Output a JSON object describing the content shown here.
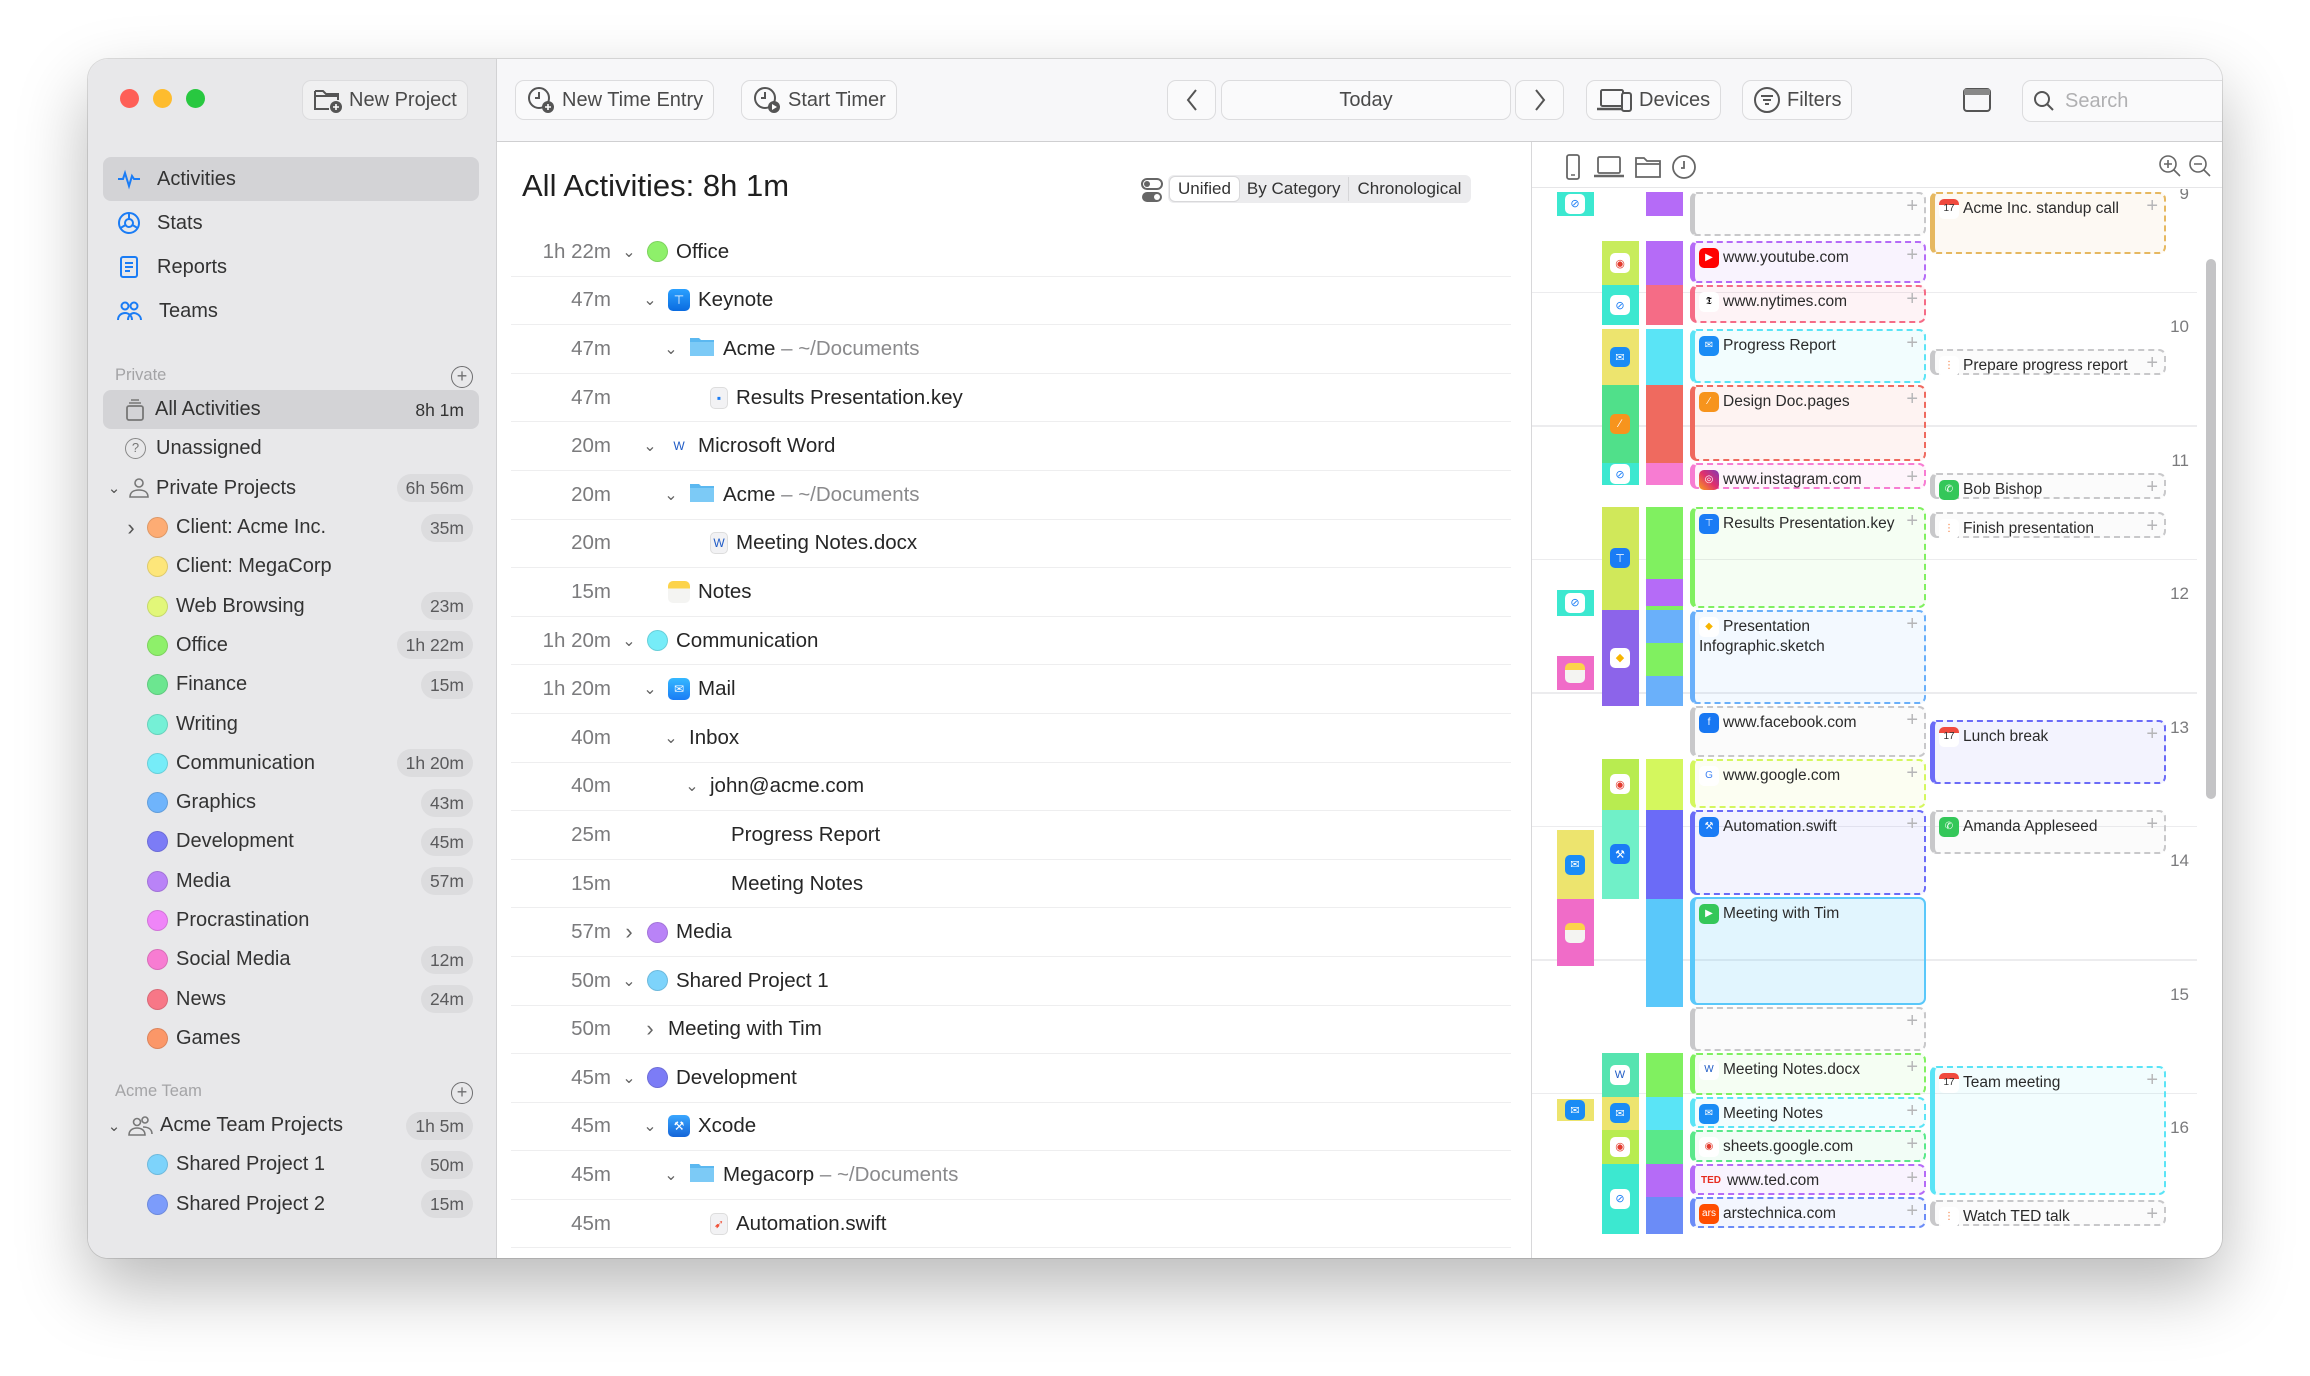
{
  "window": {
    "traffic_lights": [
      "#fe5f57",
      "#febc2e",
      "#28c840"
    ]
  },
  "sidebar": {
    "new_project_label": "New Project",
    "nav": [
      {
        "label": "Activities",
        "icon": "activity-icon",
        "active": true
      },
      {
        "label": "Stats",
        "icon": "stats-icon",
        "active": false
      },
      {
        "label": "Reports",
        "icon": "reports-icon",
        "active": false
      },
      {
        "label": "Teams",
        "icon": "teams-icon",
        "active": false
      }
    ],
    "private_section": {
      "title": "Private",
      "all_activities": {
        "label": "All Activities",
        "time": "8h 1m"
      },
      "unassigned": {
        "label": "Unassigned"
      },
      "group": {
        "label": "Private Projects",
        "time": "6h 56m"
      },
      "projects": [
        {
          "label": "Client: Acme Inc.",
          "time": "35m",
          "color": "#fdac74",
          "expandable": true
        },
        {
          "label": "Client: MegaCorp",
          "time": "",
          "color": "#fde67a"
        },
        {
          "label": "Web Browsing",
          "time": "23m",
          "color": "#e2f779"
        },
        {
          "label": "Office",
          "time": "1h 22m",
          "color": "#8ef06a"
        },
        {
          "label": "Finance",
          "time": "15m",
          "color": "#6ce690"
        },
        {
          "label": "Writing",
          "time": "",
          "color": "#75f0d6"
        },
        {
          "label": "Communication",
          "time": "1h 20m",
          "color": "#76ecf8"
        },
        {
          "label": "Graphics",
          "time": "43m",
          "color": "#6fb4fb"
        },
        {
          "label": "Development",
          "time": "45m",
          "color": "#7c7cf6"
        },
        {
          "label": "Media",
          "time": "57m",
          "color": "#b983f7"
        },
        {
          "label": "Procrastination",
          "time": "",
          "color": "#ef85f8"
        },
        {
          "label": "Social Media",
          "time": "12m",
          "color": "#f77cd2"
        },
        {
          "label": "News",
          "time": "24m",
          "color": "#f77787"
        },
        {
          "label": "Games",
          "time": "",
          "color": "#fb9768"
        }
      ]
    },
    "team_section": {
      "title": "Acme Team",
      "group": {
        "label": "Acme Team Projects",
        "time": "1h 5m"
      },
      "projects": [
        {
          "label": "Shared Project 1",
          "time": "50m",
          "color": "#7dd3fb"
        },
        {
          "label": "Shared Project 2",
          "time": "15m",
          "color": "#7c9cfb"
        }
      ]
    }
  },
  "toolbar": {
    "new_time_entry": "New Time Entry",
    "start_timer": "Start Timer",
    "date_label": "Today",
    "devices": "Devices",
    "filters": "Filters",
    "search_placeholder": "Search"
  },
  "main": {
    "title": "All Activities: 8h 1m",
    "view_modes": [
      "Unified",
      "By Category",
      "Chronological"
    ],
    "selected_view": "Unified",
    "rows": [
      {
        "time": "1h 22m",
        "level": 0,
        "chev": "down",
        "kind": "dot",
        "color": "#8ef06a",
        "label": "Office"
      },
      {
        "time": "47m",
        "level": 1,
        "chev": "down",
        "kind": "app",
        "icon": "keynote-icon",
        "label": "Keynote"
      },
      {
        "time": "47m",
        "level": 2,
        "chev": "down",
        "kind": "folder",
        "label": "Acme",
        "sub": " – ~/Documents"
      },
      {
        "time": "47m",
        "level": 3,
        "chev": "",
        "kind": "file",
        "icon": "keynote-file-icon",
        "label": "Results Presentation.key"
      },
      {
        "time": "20m",
        "level": 1,
        "chev": "down",
        "kind": "app",
        "icon": "word-icon",
        "label": "Microsoft Word"
      },
      {
        "time": "20m",
        "level": 2,
        "chev": "down",
        "kind": "folder",
        "label": "Acme",
        "sub": " – ~/Documents"
      },
      {
        "time": "20m",
        "level": 3,
        "chev": "",
        "kind": "file",
        "icon": "word-file-icon",
        "label": "Meeting Notes.docx"
      },
      {
        "time": "15m",
        "level": 1,
        "chev": "",
        "kind": "app",
        "icon": "notes-icon",
        "label": "Notes"
      },
      {
        "time": "1h 20m",
        "level": 0,
        "chev": "down",
        "kind": "dot",
        "color": "#76ecf8",
        "label": "Communication"
      },
      {
        "time": "1h 20m",
        "level": 1,
        "chev": "down",
        "kind": "app",
        "icon": "mail-icon",
        "label": "Mail"
      },
      {
        "time": "40m",
        "level": 2,
        "chev": "down",
        "kind": "none",
        "label": "Inbox"
      },
      {
        "time": "40m",
        "level": 3,
        "chev": "down",
        "kind": "none",
        "label": "john@acme.com"
      },
      {
        "time": "25m",
        "level": 4,
        "chev": "",
        "kind": "none",
        "label": "Progress Report"
      },
      {
        "time": "15m",
        "level": 4,
        "chev": "",
        "kind": "none",
        "label": "Meeting Notes"
      },
      {
        "time": "57m",
        "level": 0,
        "chev": "right",
        "kind": "dot",
        "color": "#b983f7",
        "label": "Media"
      },
      {
        "time": "50m",
        "level": 0,
        "chev": "down",
        "kind": "dot",
        "color": "#7dd3fb",
        "label": "Shared Project 1"
      },
      {
        "time": "50m",
        "level": 1,
        "chev": "right",
        "kind": "none",
        "label": "Meeting with Tim"
      },
      {
        "time": "45m",
        "level": 0,
        "chev": "down",
        "kind": "dot",
        "color": "#7c7cf6",
        "label": "Development"
      },
      {
        "time": "45m",
        "level": 1,
        "chev": "down",
        "kind": "app",
        "icon": "xcode-icon",
        "label": "Xcode"
      },
      {
        "time": "45m",
        "level": 2,
        "chev": "down",
        "kind": "folder",
        "label": "Megacorp",
        "sub": " – ~/Documents"
      },
      {
        "time": "45m",
        "level": 3,
        "chev": "",
        "kind": "file",
        "icon": "swift-file-icon",
        "label": "Automation.swift"
      }
    ]
  },
  "timeline": {
    "hours": [
      "9",
      "10",
      "11",
      "12",
      "13",
      "14",
      "15",
      "16"
    ],
    "activity_entries": [
      {
        "label": "",
        "color": "#c8c8ca",
        "start": 8.97,
        "end": 9.32,
        "icon": ""
      },
      {
        "label": "www.youtube.com",
        "color": "#b56bf7",
        "start": 9.34,
        "end": 9.67,
        "icon": "youtube-icon"
      },
      {
        "label": "www.nytimes.com",
        "color": "#f56c86",
        "start": 9.67,
        "end": 9.97,
        "icon": "nytimes-icon"
      },
      {
        "label": "Progress Report",
        "color": "#5ae4f6",
        "start": 10.0,
        "end": 10.42,
        "icon": "mail-icon"
      },
      {
        "label": "Design Doc.pages",
        "color": "#ef6a5f",
        "start": 10.42,
        "end": 11.0,
        "icon": "pages-icon"
      },
      {
        "label": "www.instagram.com",
        "color": "#f77cd2",
        "start": 11.0,
        "end": 11.17,
        "icon": "instagram-icon"
      },
      {
        "label": "Results Presentation.key",
        "color": "#80f060",
        "start": 11.33,
        "end": 12.1,
        "icon": "keynote-icon"
      },
      {
        "label": "Presentation Infographic.sketch",
        "color": "#6ab0fa",
        "start": 12.1,
        "end": 12.82,
        "icon": "sketch-icon"
      },
      {
        "label": "www.facebook.com",
        "color": "#c8c8ca",
        "start": 12.82,
        "end": 13.22,
        "icon": "facebook-icon"
      },
      {
        "label": "www.google.com",
        "color": "#d4f75e",
        "start": 13.22,
        "end": 13.6,
        "icon": "google-icon"
      },
      {
        "label": "Automation.swift",
        "color": "#6b6bf7",
        "start": 13.6,
        "end": 14.25,
        "icon": "xcode-icon"
      },
      {
        "label": "Meeting with Tim",
        "color": "#5ac8fa",
        "start": 14.25,
        "end": 15.08,
        "icon": "facetime-icon"
      },
      {
        "label": "",
        "color": "#c8c8ca",
        "start": 15.08,
        "end": 15.42,
        "icon": ""
      },
      {
        "label": "Meeting Notes.docx",
        "color": "#80f060",
        "start": 15.42,
        "end": 15.75,
        "icon": "word-icon"
      },
      {
        "label": "Meeting Notes",
        "color": "#5ae4f6",
        "start": 15.75,
        "end": 16.0,
        "icon": "mail-icon"
      },
      {
        "label": "sheets.google.com",
        "color": "#5ae88a",
        "start": 16.0,
        "end": 16.25,
        "icon": "chrome-icon"
      },
      {
        "label": "www.ted.com",
        "color": "#b56bf7",
        "start": 16.25,
        "end": 16.5,
        "icon": "ted-icon"
      },
      {
        "label": "arstechnica.com",
        "color": "#6b8cf7",
        "start": 16.5,
        "end": 16.75,
        "icon": "arstechnica-icon"
      }
    ],
    "calendar_entries": [
      {
        "label": "Acme Inc. standup call",
        "color": "#e6b860",
        "start": 8.97,
        "end": 9.45,
        "icon": "calendar-icon"
      },
      {
        "label": "Prepare progress report",
        "color": "#c8c8ca",
        "start": 10.15,
        "end": 10.32,
        "icon": "reminders-icon"
      },
      {
        "label": "Bob Bishop",
        "color": "#c8c8ca",
        "start": 11.08,
        "end": 11.25,
        "icon": "phone-icon"
      },
      {
        "label": "Finish presentation",
        "color": "#c8c8ca",
        "start": 11.37,
        "end": 11.55,
        "icon": "reminders-icon"
      },
      {
        "label": "Lunch break",
        "color": "#6b6bf7",
        "start": 12.93,
        "end": 13.42,
        "icon": "calendar-icon"
      },
      {
        "label": "Amanda Appleseed",
        "color": "#c8c8ca",
        "start": 13.6,
        "end": 13.95,
        "icon": "phone-icon"
      },
      {
        "label": "Team meeting",
        "color": "#5ae4f6",
        "start": 15.52,
        "end": 16.5,
        "icon": "calendar-icon"
      },
      {
        "label": "Watch TED talk",
        "color": "#c8c8ca",
        "start": 16.52,
        "end": 16.7,
        "icon": "reminders-icon"
      }
    ],
    "device_column": [
      {
        "icon": "safari-icon",
        "color": "#3ce8d0",
        "start": 8.97,
        "end": 9.15
      },
      {
        "icon": "safari-icon",
        "color": "#3ce8d0",
        "start": 11.95,
        "end": 12.15
      },
      {
        "icon": "notes-icon",
        "color": "#f06cc8",
        "start": 12.45,
        "end": 12.7
      },
      {
        "icon": "mail-icon",
        "color": "#ede46e",
        "start": 13.75,
        "end": 14.27
      },
      {
        "icon": "notes-icon",
        "color": "#f06cc8",
        "start": 14.27,
        "end": 14.77
      },
      {
        "icon": "mail-icon",
        "color": "#ede46e",
        "start": 15.77,
        "end": 15.93
      }
    ],
    "app_column": [
      {
        "icon": "chrome-icon",
        "color": "#c8ec5c",
        "start": 9.34,
        "end": 9.67
      },
      {
        "icon": "safari-icon",
        "color": "#3ce8d0",
        "start": 9.67,
        "end": 9.97
      },
      {
        "icon": "mail-icon",
        "color": "#ede46e",
        "start": 10.0,
        "end": 10.42
      },
      {
        "icon": "pages-icon",
        "color": "#50e08a",
        "start": 10.42,
        "end": 11.0
      },
      {
        "icon": "safari-icon",
        "color": "#3ce8d0",
        "start": 11.0,
        "end": 11.17
      },
      {
        "icon": "keynote-icon",
        "color": "#d0e85a",
        "start": 11.33,
        "end": 12.1
      },
      {
        "icon": "sketch-icon",
        "color": "#8c64ea",
        "start": 12.1,
        "end": 12.82
      },
      {
        "icon": "chrome-icon",
        "color": "#b8ec50",
        "start": 13.22,
        "end": 13.6
      },
      {
        "icon": "xcode-icon",
        "color": "#70f0c8",
        "start": 13.6,
        "end": 14.27
      },
      {
        "icon": "word-icon",
        "color": "#56e4b0",
        "start": 15.42,
        "end": 15.75
      },
      {
        "icon": "mail-icon",
        "color": "#ede46e",
        "start": 15.75,
        "end": 16.0
      },
      {
        "icon": "chrome-icon",
        "color": "#b8ec50",
        "start": 16.0,
        "end": 16.25
      },
      {
        "icon": "safari-icon",
        "color": "#3ce8d0",
        "start": 16.25,
        "end": 16.78
      }
    ],
    "category_column": [
      {
        "color": "#b56bf7",
        "start": 8.97,
        "end": 9.15
      },
      {
        "color": "#b56bf7",
        "start": 9.34,
        "end": 9.67
      },
      {
        "color": "#f56c86",
        "start": 9.67,
        "end": 9.97
      },
      {
        "color": "#5ae4f6",
        "start": 10.0,
        "end": 10.42
      },
      {
        "color": "#ef6a5f",
        "start": 10.42,
        "end": 11.0
      },
      {
        "color": "#f77cd2",
        "start": 11.0,
        "end": 11.17
      },
      {
        "color": "#80f060",
        "start": 11.33,
        "end": 11.87
      },
      {
        "color": "#b56bf7",
        "start": 11.87,
        "end": 12.07
      },
      {
        "color": "#80f060",
        "start": 12.07,
        "end": 12.1
      },
      {
        "color": "#6ab0fa",
        "start": 12.1,
        "end": 12.35
      },
      {
        "color": "#80f060",
        "start": 12.35,
        "end": 12.6
      },
      {
        "color": "#6ab0fa",
        "start": 12.6,
        "end": 12.82
      },
      {
        "color": "#d4f75e",
        "start": 13.22,
        "end": 13.6
      },
      {
        "color": "#6b6bf7",
        "start": 13.6,
        "end": 14.27
      },
      {
        "color": "#5ac8fa",
        "start": 14.27,
        "end": 15.08
      },
      {
        "color": "#80f060",
        "start": 15.42,
        "end": 15.75
      },
      {
        "color": "#5ae4f6",
        "start": 15.75,
        "end": 16.0
      },
      {
        "color": "#5ae88a",
        "start": 16.0,
        "end": 16.25
      },
      {
        "color": "#b56bf7",
        "start": 16.25,
        "end": 16.5
      },
      {
        "color": "#6b8cf7",
        "start": 16.5,
        "end": 16.78
      }
    ]
  }
}
